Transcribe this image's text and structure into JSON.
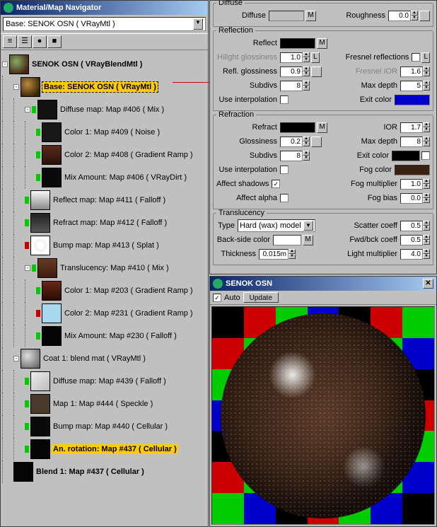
{
  "navigator": {
    "title": "Material/Map Navigator",
    "combo": "Base: SENOK OSN  ( VRayMtl )",
    "tools": {
      "list": "≡",
      "icons": "☰",
      "sphere": "●",
      "cube": "■"
    },
    "tree": [
      {
        "level": 0,
        "swatch_bg": "radial-gradient(circle at 35% 35%, #8a6 0%, #421 80%)",
        "label": "SENOK OSN  ( VRayBlendMtl )",
        "bold": true,
        "tog": "-"
      },
      {
        "level": 1,
        "swatch_bg": "radial-gradient(circle at 35% 35%, #b84 0%, #320 80%)",
        "label": "Base: SENOK OSN  ( VRayMtl )",
        "bold": true,
        "sel": true,
        "tog": "-"
      },
      {
        "level": 2,
        "swatch_bg": "#111",
        "label": "Diffuse map: Map #406  ( Mix )",
        "flag": "g",
        "tog": "-"
      },
      {
        "level": 3,
        "swatch_bg": "#181818",
        "label": "Color 1: Map #409  ( Noise )",
        "flag": "g"
      },
      {
        "level": 3,
        "swatch_bg": "linear-gradient(#5a2b1a,#2b1008)",
        "label": "Color 2: Map #408  ( Gradient Ramp )",
        "flag": "g"
      },
      {
        "level": 3,
        "swatch_bg": "#0a0a0a",
        "label": "Mix Amount: Map #406  ( VRayDirt )",
        "flag": "g"
      },
      {
        "level": 2,
        "swatch_bg": "linear-gradient(#f8f8f8,#888)",
        "label": "Reflect map: Map #411  ( Falloff )",
        "flag": "g"
      },
      {
        "level": 2,
        "swatch_bg": "linear-gradient(#222,#555)",
        "label": "Refract map: Map #412  ( Falloff )",
        "flag": "g"
      },
      {
        "level": 2,
        "swatch_bg": "radial-gradient(#fff 30%, #eee 31%, #fff 60%)",
        "label": "Bump map: Map #413  ( Splat )",
        "flag": "r"
      },
      {
        "level": 2,
        "swatch_bg": "linear-gradient(#6a3a22,#3a1e10)",
        "label": "Translucency: Map #410  ( Mix )",
        "flag": "g",
        "tog": "-"
      },
      {
        "level": 3,
        "swatch_bg": "linear-gradient(#6a2818,#2a0c06)",
        "label": "Color 1: Map #203  ( Gradient Ramp )",
        "flag": "g"
      },
      {
        "level": 3,
        "swatch_bg": "#a8d8f0",
        "label": "Color 2: Map #231  ( Gradient Ramp )",
        "flag": "r"
      },
      {
        "level": 3,
        "swatch_bg": "#050505",
        "label": "Mix Amount: Map #230  ( Falloff )",
        "flag": "g"
      },
      {
        "level": 1,
        "swatch_bg": "radial-gradient(circle at 35% 35%, #ddd 0%, #666 90%)",
        "label": "Coat 1: blend mat  ( VRayMtl )",
        "tog": "-"
      },
      {
        "level": 2,
        "swatch_bg": "linear-gradient(135deg,#eee,#bbb)",
        "label": "Diffuse map: Map #439  ( Falloff )",
        "flag": "g"
      },
      {
        "level": 2,
        "swatch_bg": "#4a3a2a",
        "label": "Map 1: Map #444  ( Speckle )",
        "flag": "g"
      },
      {
        "level": 2,
        "swatch_bg": "#0a0a0a",
        "label": "Bump map: Map #440  ( Cellular )",
        "flag": "g"
      },
      {
        "level": 2,
        "swatch_bg": "#050505",
        "label": "An. rotation: Map #437  ( Cellular )",
        "bold": true,
        "sel2": true,
        "flag": "g"
      },
      {
        "level": 1,
        "swatch_bg": "#050505",
        "label": "Blend 1: Map #437  ( Cellular )",
        "bold": true
      }
    ]
  },
  "params": {
    "diffuse": {
      "legend": "Diffuse",
      "label": "Diffuse",
      "color": "#000000",
      "m": "M",
      "roughness_label": "Roughness",
      "roughness": "0.0"
    },
    "reflection": {
      "legend": "Reflection",
      "reflect_label": "Reflect",
      "reflect_color": "#000000",
      "m": "M",
      "hilight_label": "Hilight glossiness",
      "hilight": "1.0",
      "l": "L",
      "fresnel_refl_label": "Fresnel reflections",
      "refl_gloss_label": "Refl. glossiness",
      "refl_gloss": "0.9",
      "fresnel_ior_label": "Fresnel IOR",
      "fresnel_ior": "1.6",
      "subdivs_label": "Subdivs",
      "subdivs": "8",
      "max_depth_label": "Max depth",
      "max_depth": "5",
      "use_interp_label": "Use interpolation",
      "exit_color_label": "Exit color",
      "exit_color": "#0000cc"
    },
    "refraction": {
      "legend": "Refraction",
      "refract_label": "Refract",
      "refract_color": "#000000",
      "m": "M",
      "ior_label": "IOR",
      "ior": "1.7",
      "gloss_label": "Glossiness",
      "gloss": "0.2",
      "max_depth_label": "Max depth",
      "max_depth": "8",
      "subdivs_label": "Subdivs",
      "subdivs": "8",
      "exit_color_label": "Exit color",
      "exit_color": "#000000",
      "use_interp_label": "Use interpolation",
      "fog_color_label": "Fog color",
      "fog_color": "#3a2010",
      "affect_shadows_label": "Affect shadows",
      "fog_mult_label": "Fog multiplier",
      "fog_mult": "1.0",
      "affect_alpha_label": "Affect alpha",
      "fog_bias_label": "Fog bias",
      "fog_bias": "0.0"
    },
    "translucency": {
      "legend": "Translucency",
      "type_label": "Type",
      "type": "Hard (wax) model",
      "scatter_label": "Scatter coeff",
      "scatter": "0.5",
      "back_label": "Back-side color",
      "back_color": "#ffffff",
      "m": "M",
      "fwd_label": "Fwd/bck coeff",
      "fwd": "0.5",
      "thick_label": "Thickness",
      "thick": "0.015m",
      "light_label": "Light multiplier",
      "light": "4.0"
    }
  },
  "preview": {
    "title": "SENOK OSN",
    "auto_label": "Auto",
    "update_label": "Update"
  },
  "checker_colors": [
    "#000",
    "#c00",
    "#0c0",
    "#00c",
    "#000",
    "#c00",
    "#0c0",
    "#c00",
    "#0c0",
    "#00c",
    "#000",
    "#c00",
    "#0c0",
    "#00c",
    "#0c0",
    "#00c",
    "#000",
    "#c00",
    "#0c0",
    "#00c",
    "#000",
    "#00c",
    "#000",
    "#c00",
    "#0c0",
    "#00c",
    "#000",
    "#c00",
    "#000",
    "#c00",
    "#0c0",
    "#00c",
    "#000",
    "#c00",
    "#0c0",
    "#c00",
    "#0c0",
    "#00c",
    "#000",
    "#c00",
    "#0c0",
    "#00c",
    "#0c0",
    "#00c",
    "#000",
    "#c00",
    "#0c0",
    "#00c",
    "#000"
  ]
}
